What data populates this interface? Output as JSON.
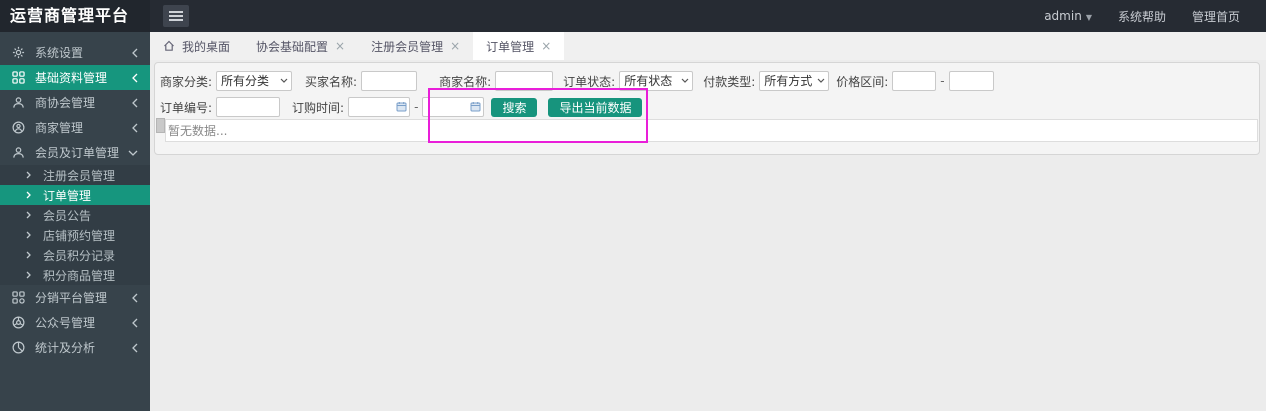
{
  "colors": {
    "accent": "#16967e",
    "annotation": "#e91ed9",
    "topbar_bg": "#262b33",
    "sidebar_bg": "#37434b"
  },
  "topbar": {
    "title": "运营商管理平台",
    "user": "admin",
    "caret": "▼",
    "help": "系统帮助",
    "home": "管理首页"
  },
  "tabs": [
    {
      "label": "我的桌面",
      "closable": false,
      "active": false
    },
    {
      "label": "协会基础配置",
      "close": "×",
      "closable": true,
      "active": false
    },
    {
      "label": "注册会员管理",
      "close": "×",
      "closable": true,
      "active": false
    },
    {
      "label": "订单管理",
      "close": "×",
      "closable": true,
      "active": true
    }
  ],
  "sidebar": {
    "items": [
      {
        "label": "系统设置",
        "icon": "gear-icon"
      },
      {
        "label": "基础资料管理",
        "icon": "grid-icon",
        "highlighted": true
      },
      {
        "label": "商协会管理",
        "icon": "user-icon"
      },
      {
        "label": "商家管理",
        "icon": "user-circle-icon"
      },
      {
        "label": "会员及订单管理",
        "icon": "user-icon",
        "expanded": true,
        "children": [
          {
            "label": "注册会员管理",
            "active": false
          },
          {
            "label": "订单管理",
            "active": true
          },
          {
            "label": "会员公告",
            "active": false
          },
          {
            "label": "店铺预约管理",
            "active": false
          },
          {
            "label": "会员积分记录",
            "active": false
          },
          {
            "label": "积分商品管理",
            "active": false
          }
        ]
      },
      {
        "label": "分销平台管理",
        "icon": "share-icon"
      },
      {
        "label": "公众号管理",
        "icon": "wheel-icon"
      },
      {
        "label": "统计及分析",
        "icon": "pie-icon"
      }
    ]
  },
  "filters": {
    "merchant_category": {
      "label": "商家分类:",
      "value": "所有分类"
    },
    "buyer_name": {
      "label": "买家名称:",
      "value": ""
    },
    "merchant_name": {
      "label": "商家名称:",
      "value": ""
    },
    "order_status": {
      "label": "订单状态:",
      "value": "所有状态"
    },
    "payment_type": {
      "label": "付款类型:",
      "value": "所有方式"
    },
    "price_range": {
      "label": "价格区间:",
      "separator": "-",
      "min": "",
      "max": ""
    },
    "order_no": {
      "label": "订单编号:",
      "value": ""
    },
    "order_time": {
      "label": "订购时间:",
      "separator": "-",
      "from": "",
      "to": ""
    },
    "search_button": "搜索",
    "export_button": "导出当前数据"
  },
  "table": {
    "empty_text": "暂无数据..."
  }
}
